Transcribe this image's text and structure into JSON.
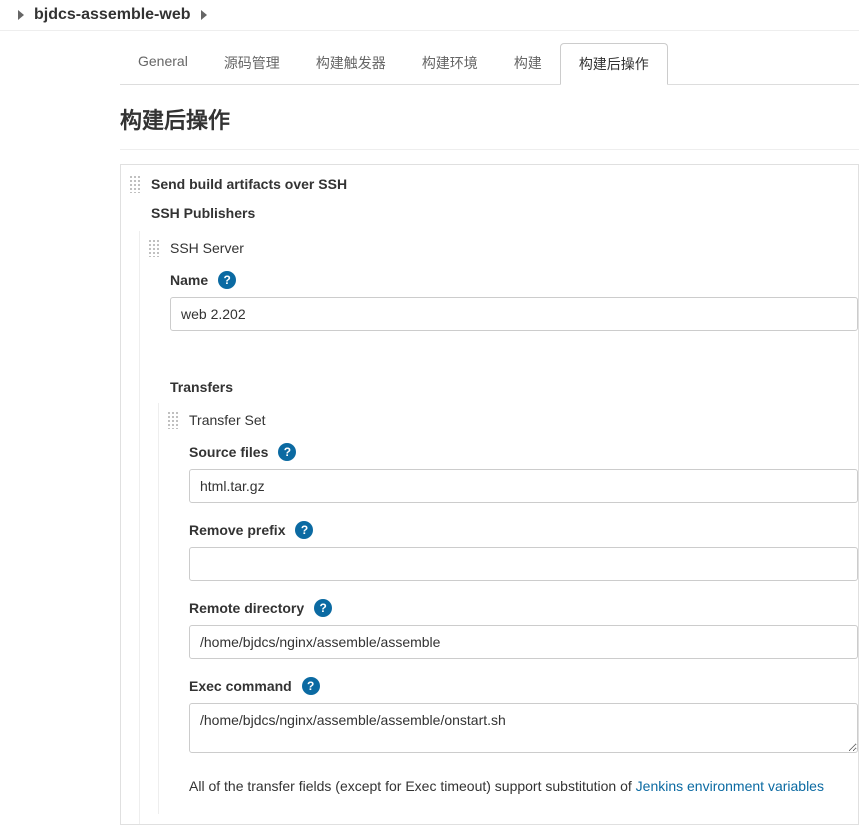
{
  "breadcrumb": {
    "project": "bjdcs-assemble-web"
  },
  "tabs": [
    {
      "label": "General",
      "active": false
    },
    {
      "label": "源码管理",
      "active": false
    },
    {
      "label": "构建触发器",
      "active": false
    },
    {
      "label": "构建环境",
      "active": false
    },
    {
      "label": "构建",
      "active": false
    },
    {
      "label": "构建后操作",
      "active": true
    }
  ],
  "section": {
    "title": "构建后操作"
  },
  "ssh": {
    "block_title": "Send build artifacts over SSH",
    "publishers_label": "SSH Publishers",
    "server_label": "SSH Server",
    "name_label": "Name",
    "name_value": "web 2.202",
    "transfers_label": "Transfers",
    "transfer_set_label": "Transfer Set",
    "source_files_label": "Source files",
    "source_files_value": "html.tar.gz",
    "remove_prefix_label": "Remove prefix",
    "remove_prefix_value": "",
    "remote_directory_label": "Remote directory",
    "remote_directory_value": "/home/bjdcs/nginx/assemble/assemble",
    "exec_command_label": "Exec command",
    "exec_command_value": "/home/bjdcs/nginx/assemble/assemble/onstart.sh",
    "footnote_prefix": "All of the transfer fields (except for Exec timeout) support substitution of ",
    "footnote_link": "Jenkins environment variables"
  }
}
